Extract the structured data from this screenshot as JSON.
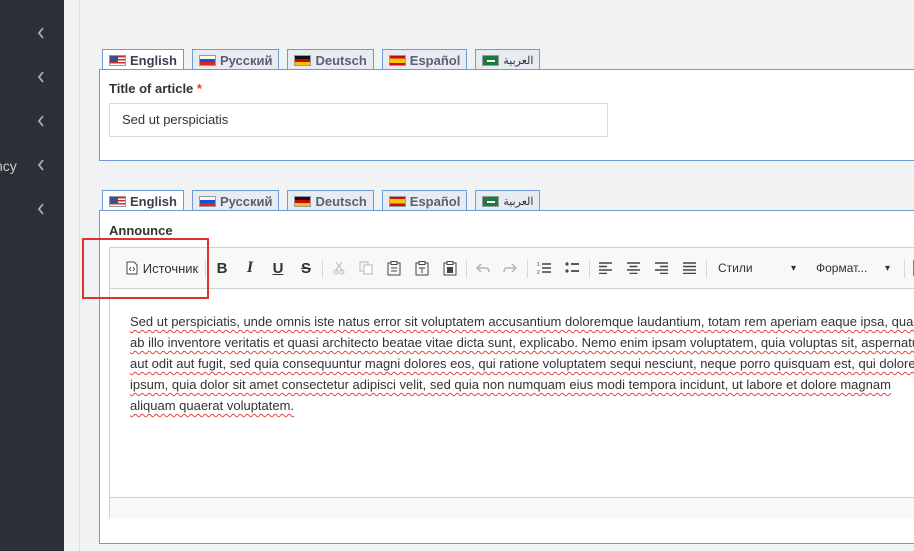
{
  "sidebar": {
    "items": [
      {
        "label": "",
        "chevron": "‹"
      },
      {
        "label": "",
        "chevron": "‹"
      },
      {
        "label": "",
        "chevron": "‹"
      },
      {
        "label": "ncy",
        "chevron": "‹"
      },
      {
        "label": "",
        "chevron": "‹"
      }
    ]
  },
  "languages": [
    {
      "label": "English",
      "flag": "us-flag-icon"
    },
    {
      "label": "Русский",
      "flag": "ru-flag-icon"
    },
    {
      "label": "Deutsch",
      "flag": "de-flag-icon"
    },
    {
      "label": "Español",
      "flag": "es-flag-icon"
    },
    {
      "label": "العربية",
      "flag": "sa-flag-icon"
    }
  ],
  "title_field": {
    "label": "Title of article",
    "required_mark": "*",
    "value": "Sed ut perspiciatis"
  },
  "announce_field": {
    "label": "Announce",
    "text": "Sed ut perspiciatis, unde omnis iste natus error sit voluptatem accusantium doloremque laudantium, totam rem aperiam eaque ipsa, quae ab illo inventore veritatis et quasi architecto beatae vitae dicta sunt, explicabo. Nemo enim ipsam voluptatem, quia voluptas sit, aspernatur aut odit aut fugit, sed quia consequuntur magni dolores eos, qui ratione voluptatem sequi nesciunt, neque porro quisquam est, qui dolorem ipsum, quia dolor sit amet consectetur adipisci velit, sed quia non numquam eius modi tempora incidunt, ut labore et dolore magnam aliquam quaerat voluptatem."
  },
  "toolbar": {
    "source_label": "Источник",
    "bold": "B",
    "italic": "I",
    "underline": "U",
    "strike": "S",
    "styles_label": "Стили",
    "format_label": "Формат...",
    "dropdown_arrow": "▾"
  },
  "colors": {
    "sidebar_bg": "#2a3035",
    "tab_border": "#6e9ad6",
    "highlight": "#e0322f",
    "spell_underline": "#e04545"
  }
}
